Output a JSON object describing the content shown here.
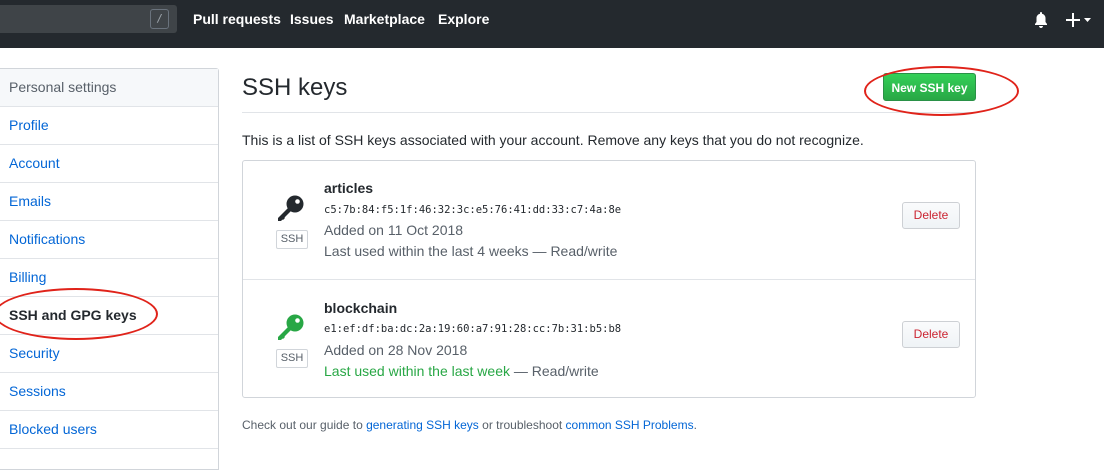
{
  "header": {
    "search_shortcut": "/",
    "nav": [
      "Pull requests",
      "Issues",
      "Marketplace",
      "Explore"
    ],
    "icons": [
      "bell-icon",
      "plus-icon",
      "caret-down-icon"
    ]
  },
  "sidebar": {
    "heading": "Personal settings",
    "items": [
      {
        "label": "Profile"
      },
      {
        "label": "Account"
      },
      {
        "label": "Emails"
      },
      {
        "label": "Notifications"
      },
      {
        "label": "Billing"
      },
      {
        "label": "SSH and GPG keys",
        "selected": true
      },
      {
        "label": "Security"
      },
      {
        "label": "Sessions"
      },
      {
        "label": "Blocked users"
      }
    ]
  },
  "main": {
    "title": "SSH keys",
    "new_button": "New SSH key",
    "description": "This is a list of SSH keys associated with your account. Remove any keys that you do not recognize.",
    "keys": [
      {
        "name": "articles",
        "fingerprint": "c5:7b:84:f5:1f:46:32:3c:e5:76:41:dd:33:c7:4a:8e",
        "added": "Added on 11 Oct 2018",
        "last_used": "Last used within the last 4 weeks",
        "last_used_suffix": " — Read/write",
        "badge": "SSH",
        "delete_label": "Delete",
        "icon_color": "#24292e"
      },
      {
        "name": "blockchain",
        "fingerprint": "e1:ef:df:ba:dc:2a:19:60:a7:91:28:cc:7b:31:b5:b8",
        "added": "Added on 28 Nov 2018",
        "last_used": "Last used within the last week",
        "last_used_suffix": " — Read/write",
        "badge": "SSH",
        "delete_label": "Delete",
        "icon_color": "#28a745"
      }
    ],
    "footer": {
      "prefix": "Check out our guide to ",
      "link1": "generating SSH keys",
      "middle": " or troubleshoot ",
      "link2": "common SSH Problems",
      "suffix": "."
    }
  },
  "colors": {
    "header_bg": "#24292e",
    "primary_green": "#28a745",
    "link_blue": "#0366d6",
    "danger_red": "#cb2431",
    "annotation_red": "#e0231a"
  }
}
